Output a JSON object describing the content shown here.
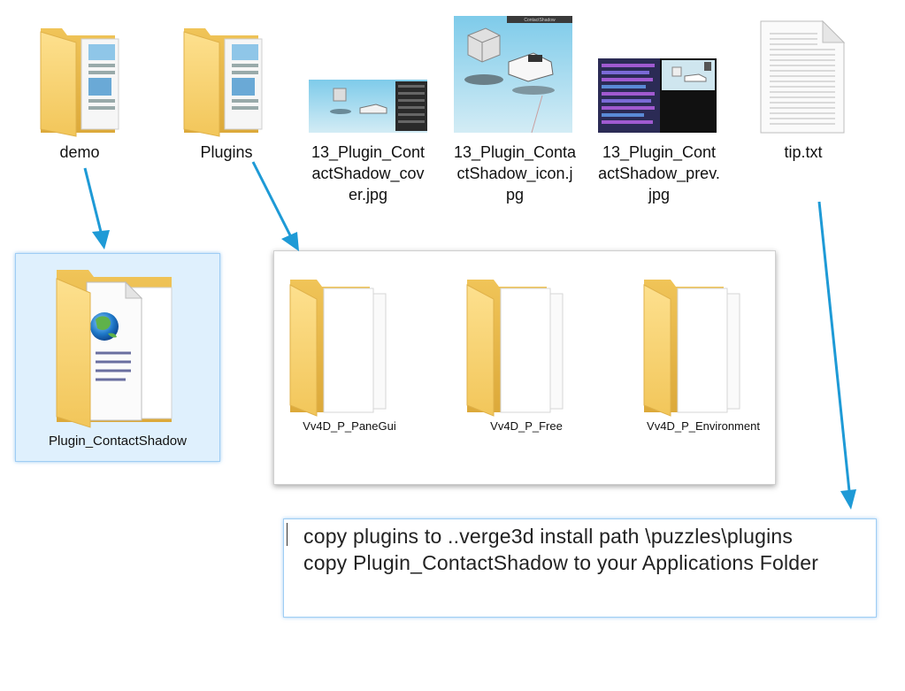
{
  "top_items": [
    {
      "name": "demo",
      "label": "demo",
      "kind": "folder"
    },
    {
      "name": "plugins",
      "label": "Plugins",
      "kind": "folder"
    },
    {
      "name": "cover",
      "label": "13_Plugin_ContactShadow_cover.jpg",
      "kind": "image"
    },
    {
      "name": "icon",
      "label": "13_Plugin_ContactShadow_icon.jpg",
      "kind": "image"
    },
    {
      "name": "prev",
      "label": "13_Plugin_ContactShadow_prev.jpg",
      "kind": "image"
    },
    {
      "name": "tip",
      "label": "tip.txt",
      "kind": "text-file"
    }
  ],
  "thumbnail_overlay": {
    "title": "ContactShadow"
  },
  "demo_folder": {
    "label": "Plugin_ContactShadow",
    "state": "selected"
  },
  "plugins_window": {
    "items": [
      {
        "label": "Vv4D_P_PaneGui"
      },
      {
        "label": "Vv4D_P_Free"
      },
      {
        "label": "Vv4D_P_Environment"
      }
    ]
  },
  "note": {
    "lines": [
      "copy plugins  to  ..verge3d install path \\puzzles\\plugins",
      "copy  Plugin_ContactShadow  to  your  Applications Folder"
    ]
  },
  "colors": {
    "arrow": "#1e9ad6",
    "folder_back": "#e8b947",
    "folder_front": "#fbd77c",
    "selection_bg": "#dff0fd",
    "selection_border": "#9fcdf4"
  }
}
